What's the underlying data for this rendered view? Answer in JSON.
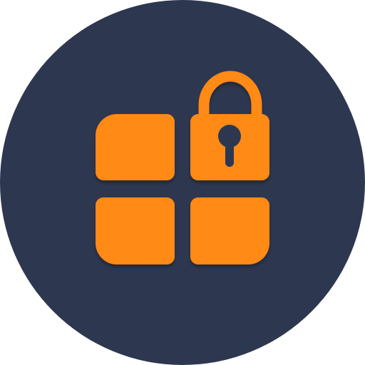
{
  "icon": {
    "name": "app-lock-icon",
    "colors": {
      "background": "#2e3750",
      "tile": "#ff8a19",
      "tile_shadow": "#1b2236",
      "keyhole": "#2e3750"
    }
  }
}
